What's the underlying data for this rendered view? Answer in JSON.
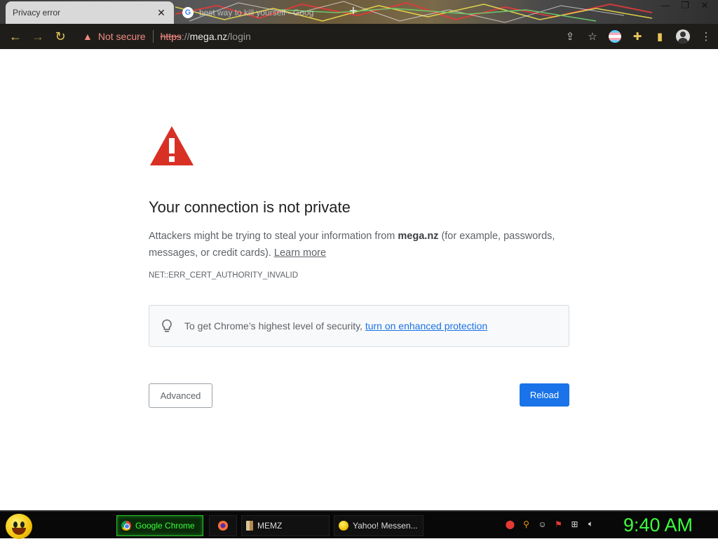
{
  "browser": {
    "tabs": [
      {
        "title": "Privacy error",
        "active": true
      },
      {
        "title": "best way to kill yourself - Goog",
        "active": false
      }
    ],
    "address": {
      "security_label": "Not secure",
      "scheme": "https",
      "separator": "://",
      "host": "mega.nz",
      "path": "/login"
    }
  },
  "page": {
    "heading": "Your connection is not private",
    "description_prefix": "Attackers might be trying to steal your information from ",
    "description_host": "mega.nz",
    "description_suffix": " (for example, passwords, messages, or credit cards). ",
    "learn_more": "Learn more",
    "error_code": "NET::ERR_CERT_AUTHORITY_INVALID",
    "enhanced_prefix": "To get Chrome’s highest level of security, ",
    "enhanced_link": "turn on enhanced protection",
    "advanced_label": "Advanced",
    "reload_label": "Reload"
  },
  "taskbar": {
    "items": [
      {
        "label": "Google Chrome",
        "icon": "chrome-icon",
        "active": true
      },
      {
        "label": "",
        "icon": "firefox-icon",
        "active": false
      },
      {
        "label": "MEMZ",
        "icon": "memz-icon",
        "active": false
      },
      {
        "label": "Yahoo! Messen...",
        "icon": "yahoo-icon",
        "active": false
      }
    ],
    "clock": "9:40 AM"
  },
  "colors": {
    "alert_red": "#d93025",
    "link_blue": "#1a73e8",
    "taskbar_green": "#3cff3c"
  }
}
